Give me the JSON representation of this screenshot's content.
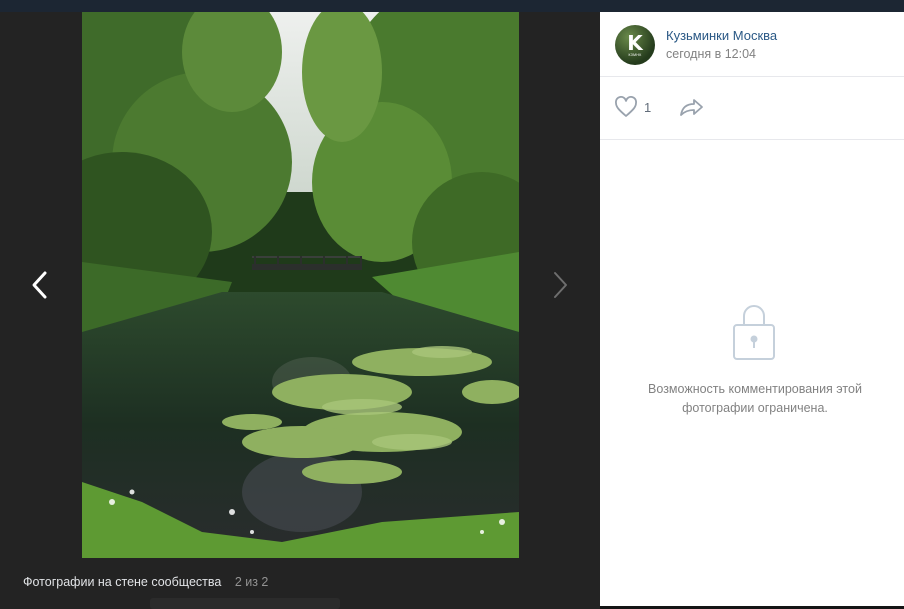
{
  "viewer": {
    "caption": "Фотографии на стене сообщества",
    "counter": "2 из 2",
    "prev_icon": "chevron-left-icon",
    "next_icon": "chevron-right-icon"
  },
  "post": {
    "author": "Кузьминки Москва",
    "avatar_letter": "K",
    "avatar_sub": "КЗМНК",
    "time": "сегодня в 12:04",
    "likes": "1",
    "like_icon": "heart-icon",
    "share_icon": "share-arrow-icon"
  },
  "comments": {
    "restricted_text": "Возможность комментирования этой фотографии ограничена.",
    "lock_icon": "lock-icon"
  },
  "colors": {
    "link": "#2a5885",
    "muted": "#828282",
    "viewer_bg": "#232323",
    "panel_bg": "#ffffff"
  }
}
